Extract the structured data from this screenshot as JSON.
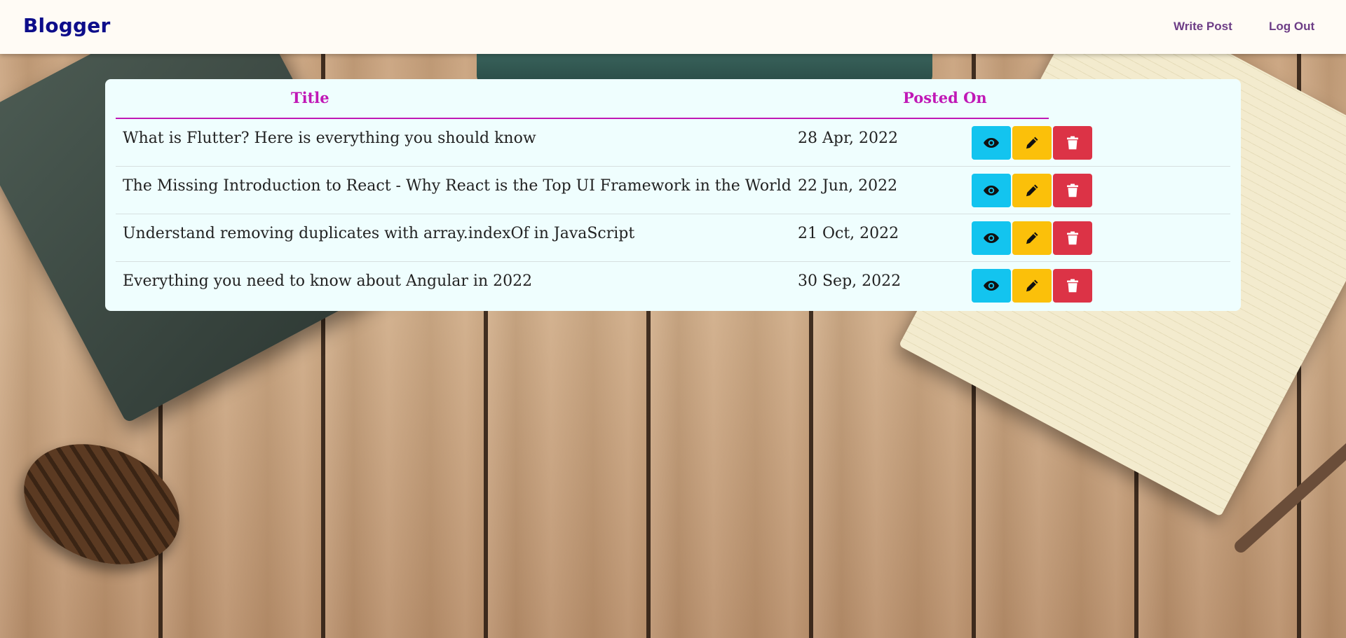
{
  "navbar": {
    "brand": "Blogger",
    "links": {
      "write_post": "Write Post",
      "log_out": "Log Out"
    }
  },
  "table": {
    "headers": {
      "title": "Title",
      "posted_on": "Posted On"
    },
    "rows": [
      {
        "title": "What is Flutter? Here is everything you should know",
        "posted_on": "28 Apr, 2022"
      },
      {
        "title": "The Missing Introduction to React - Why React is the Top UI Framework in the World",
        "posted_on": "22 Jun, 2022"
      },
      {
        "title": "Understand removing duplicates with array.indexOf in JavaScript",
        "posted_on": "21 Oct, 2022"
      },
      {
        "title": "Everything you need to know about Angular in 2022",
        "posted_on": "30 Sep, 2022"
      }
    ],
    "actions": [
      {
        "icon": "eye-icon",
        "color": "#13c4ef"
      },
      {
        "icon": "pencil-icon",
        "color": "#fbc00a"
      },
      {
        "icon": "trash-icon",
        "color": "#dc3346"
      }
    ]
  },
  "colors": {
    "brand": "#0d0d8a",
    "nav_link": "#6d3d86",
    "header_accent": "#c018b6",
    "panel_bg": "#effefe",
    "navbar_bg": "#fffbf5"
  }
}
